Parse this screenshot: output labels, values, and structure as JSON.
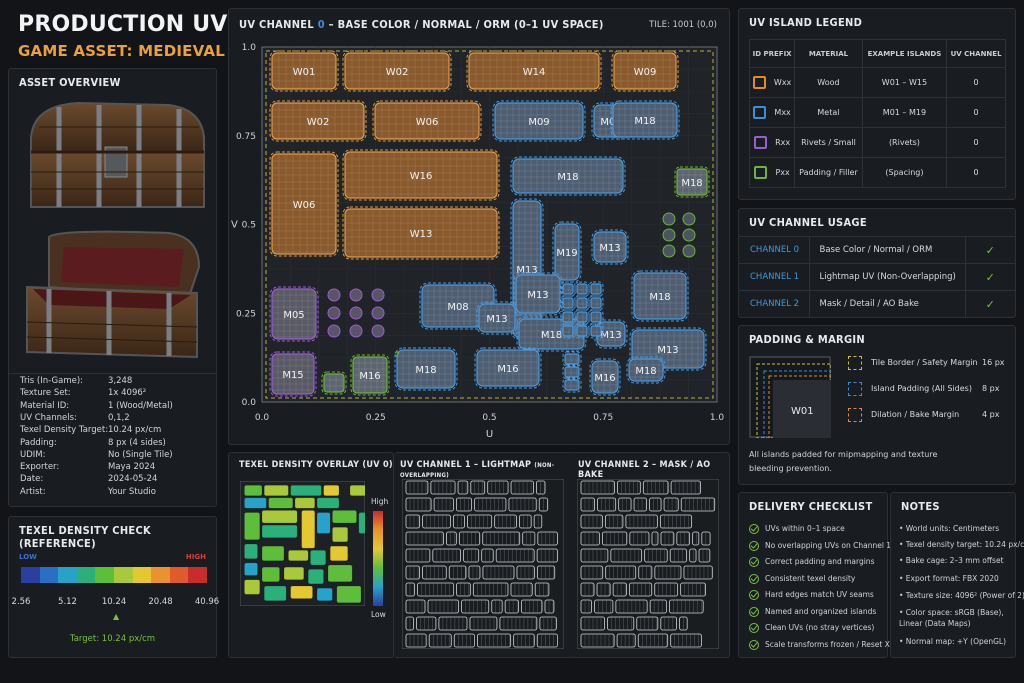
{
  "header": {
    "title": "PRODUCTION UV SHEET",
    "subtitle": "GAME ASSET: MEDIEVAL CHEST"
  },
  "asset_overview": {
    "title": "ASSET OVERVIEW",
    "specs": [
      {
        "label": "Tris (In-Game):",
        "value": "3,248"
      },
      {
        "label": "Texture Set:",
        "value": "1x 4096²"
      },
      {
        "label": "Material ID:",
        "value": "1 (Wood/Metal)"
      },
      {
        "label": "UV Channels:",
        "value": "0,1,2"
      },
      {
        "label": "Texel Density Target:",
        "value": "10.24 px/cm"
      },
      {
        "label": "Padding:",
        "value": "8 px (4 sides)"
      },
      {
        "label": "UDIM:",
        "value": "No (Single Tile)"
      },
      {
        "label": "Exporter:",
        "value": "Maya 2024"
      },
      {
        "label": "Date:",
        "value": "2024-05-24"
      },
      {
        "label": "Artist:",
        "value": "Your Studio"
      }
    ]
  },
  "texel_check": {
    "title": "TEXEL DENSITY CHECK (REFERENCE)",
    "low": "LOW",
    "high": "HIGH",
    "ticks": [
      "2.56",
      "5.12",
      "10.24",
      "20.48",
      "40.96"
    ],
    "target": "Target: 10.24 px/cm",
    "colors": [
      "#2c3f9e",
      "#2a6fc4",
      "#27a3c9",
      "#2bb07a",
      "#5fbd3c",
      "#a9c93a",
      "#e3c832",
      "#e9922f",
      "#e05a2b",
      "#c92d2b"
    ]
  },
  "uv_main": {
    "title_prefix": "UV CHANNEL ",
    "title_num": "0",
    "title_suffix": " – BASE COLOR / NORMAL / ORM (0–1 UV SPACE)",
    "tile": "TILE: 1001 (0,0)",
    "x_ticks": [
      "0.0",
      "0.25",
      "0.5",
      "0.75",
      "1.0"
    ],
    "y_ticks": [
      "1.0",
      "0.75",
      "0.5",
      "0.25",
      "0.0"
    ],
    "xlabel": "U",
    "ylabel": "V",
    "islands_wood": [
      "W01",
      "W02",
      "W14",
      "W09",
      "W02",
      "W06",
      "W06",
      "W16",
      "W13"
    ],
    "islands_metal": [
      "M09",
      "M08",
      "M18",
      "M18",
      "M13",
      "M19",
      "M13",
      "M13",
      "M08",
      "M13",
      "M18",
      "M13",
      "M18",
      "M13",
      "M18",
      "M16",
      "M16",
      "M18"
    ],
    "islands_rivet": [
      "M05",
      "M15",
      "M16"
    ],
    "islands_pad": [
      "M18",
      "M15"
    ]
  },
  "legend": {
    "title": "UV ISLAND LEGEND",
    "headers": [
      "ID PREFIX",
      "MATERIAL",
      "EXAMPLE ISLANDS",
      "UV CHANNEL"
    ],
    "rows": [
      {
        "prefix": "Wxx",
        "material": "Wood",
        "examples": "W01 – W15",
        "channel": "0",
        "color": "#e08a2e"
      },
      {
        "prefix": "Mxx",
        "material": "Metal",
        "examples": "M01 – M19",
        "channel": "0",
        "color": "#3b8fd6"
      },
      {
        "prefix": "Rxx",
        "material": "Rivets / Small",
        "examples": "(Rivets)",
        "channel": "0",
        "color": "#9a5fcf"
      },
      {
        "prefix": "Pxx",
        "material": "Padding / Filler",
        "examples": "(Spacing)",
        "channel": "0",
        "color": "#6fb33c"
      }
    ]
  },
  "usage": {
    "title": "UV CHANNEL USAGE",
    "rows": [
      {
        "channel": "CHANNEL 0",
        "use": "Base Color / Normal / ORM"
      },
      {
        "channel": "CHANNEL 1",
        "use": "Lightmap UV (Non-Overlapping)"
      },
      {
        "channel": "CHANNEL 2",
        "use": "Mask / Detail / AO Bake"
      }
    ]
  },
  "padding": {
    "title": "PADDING & MARGIN",
    "island": "W01",
    "items": [
      {
        "label": "Tile Border / Safety Margin",
        "value": "16 px",
        "color": "#c9c23a"
      },
      {
        "label": "Island Padding (All Sides)",
        "value": "8 px",
        "color": "#3b8fd6"
      },
      {
        "label": "Dilation / Bake Margin",
        "value": "4 px",
        "color": "#e08a2e"
      }
    ],
    "note": "All islands padded for mipmapping and texture bleeding prevention."
  },
  "overlay": {
    "title": "TEXEL DENSITY OVERLAY (UV 0)",
    "high": "High",
    "low": "Low"
  },
  "ch1": {
    "title": "UV CHANNEL 1 – LIGHTMAP",
    "sub": "(NON-OVERLAPPING)"
  },
  "ch2": {
    "title": "UV CHANNEL 2 – MASK / AO BAKE"
  },
  "checklist": {
    "title": "DELIVERY CHECKLIST",
    "items": [
      "UVs within 0–1 space",
      "No overlapping UVs on Channel 1",
      "Correct padding and margins",
      "Consistent texel density",
      "Hard edges match UV seams",
      "Named and organized islands",
      "Clean UVs (no stray vertices)",
      "Scale transforms frozen / Reset XForm"
    ]
  },
  "notes": {
    "title": "NOTES",
    "items": [
      "• World units: Centimeters",
      "• Texel density target: 10.24 px/cm",
      "• Bake cage: 2–3 mm offset",
      "• Export format: FBX 2020",
      "• Texture size: 4096² (Power of 2)",
      "• Color space: sRGB (Base),",
      "  Linear (Data Maps)",
      "• Normal map: +Y (OpenGL)"
    ]
  }
}
